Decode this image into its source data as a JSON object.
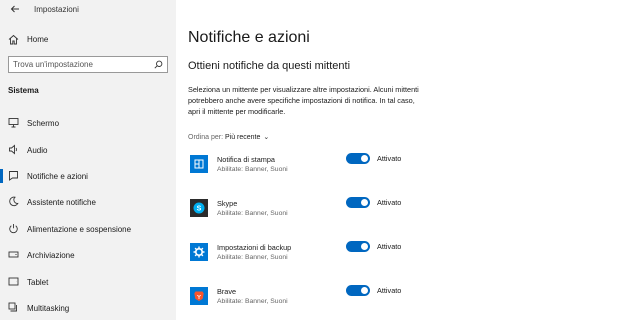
{
  "window": {
    "title": "Impostazioni",
    "back_icon": "back-arrow-icon"
  },
  "sidebar": {
    "home_label": "Home",
    "search_placeholder": "Trova un'impostazione",
    "section_label": "Sistema",
    "items": [
      {
        "label": "Schermo",
        "icon": "monitor-icon",
        "selected": false
      },
      {
        "label": "Audio",
        "icon": "speaker-icon",
        "selected": false
      },
      {
        "label": "Notifiche e azioni",
        "icon": "notification-icon",
        "selected": true
      },
      {
        "label": "Assistente notifiche",
        "icon": "moon-icon",
        "selected": false
      },
      {
        "label": "Alimentazione e sospensione",
        "icon": "power-icon",
        "selected": false
      },
      {
        "label": "Archiviazione",
        "icon": "storage-icon",
        "selected": false
      },
      {
        "label": "Tablet",
        "icon": "tablet-icon",
        "selected": false
      },
      {
        "label": "Multitasking",
        "icon": "multitasking-icon",
        "selected": false
      }
    ]
  },
  "main": {
    "title": "Notifiche e azioni",
    "subtitle": "Ottieni notifiche da questi mittenti",
    "description": "Seleziona un mittente per visualizzare altre impostazioni. Alcuni mittenti potrebbero anche avere specifiche impostazioni di notifica. In tal caso, apri il mittente per modificarle.",
    "sort_prefix": "Ordina per: ",
    "sort_value": "Più recente",
    "apps": [
      {
        "name": "Notifica di stampa",
        "detail": "Abilitate: Banner, Suoni",
        "toggle_label": "Attivato",
        "on": true,
        "icon": "print-notification-icon",
        "tile_color": "#0078d4"
      },
      {
        "name": "Skype",
        "detail": "Abilitate: Banner, Suoni",
        "toggle_label": "Attivato",
        "on": true,
        "icon": "skype-icon",
        "tile_color": "#2b2b2b"
      },
      {
        "name": "Impostazioni di backup",
        "detail": "Abilitate: Banner, Suoni",
        "toggle_label": "Attivato",
        "on": true,
        "icon": "backup-gear-icon",
        "tile_color": "#0078d4"
      },
      {
        "name": "Brave",
        "detail": "Abilitate: Banner, Suoni",
        "toggle_label": "Attivato",
        "on": true,
        "icon": "brave-icon",
        "tile_color": "#0078d4"
      }
    ]
  },
  "colors": {
    "accent": "#0067c0",
    "sidebar_bg": "#f2f2f2",
    "skype": "#00aff0",
    "brave": "#fb542b"
  }
}
